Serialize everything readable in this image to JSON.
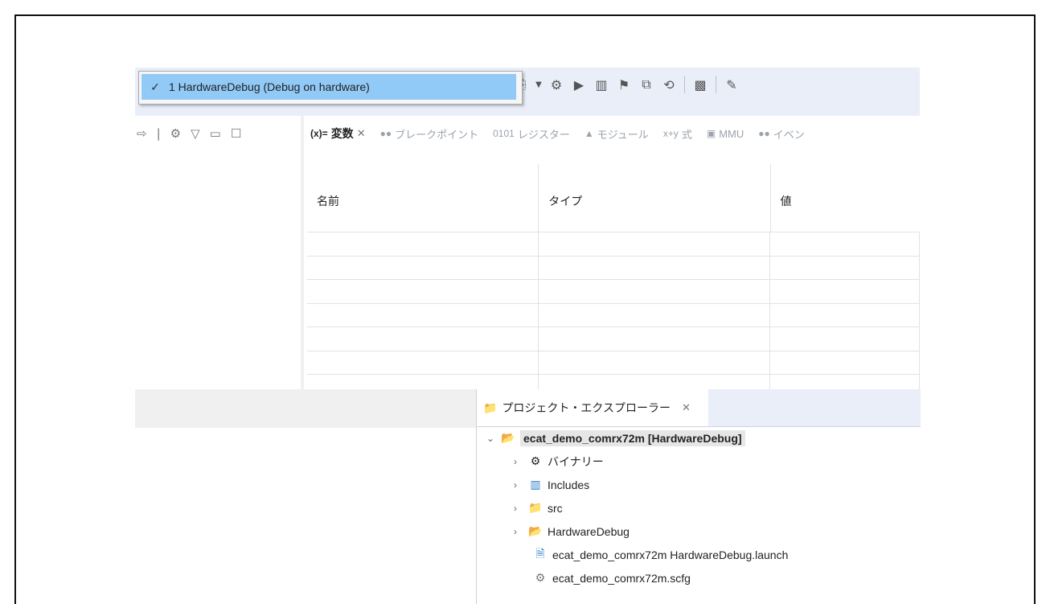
{
  "run_menu": {
    "items": [
      {
        "index_label": "1 HardwareDebug (Debug on hardware)",
        "checked": true
      }
    ]
  },
  "toolbar": {
    "icons": [
      "hammer-icon",
      "binary-icon",
      "debug-monitor-icon",
      "skip-breakpoints-icon",
      "resume-icon",
      "suspend-icon",
      "terminate-icon",
      "disconnect-icon",
      "step-into-icon",
      "step-over-icon",
      "step-return-icon",
      "instruction-step-icon",
      "use-step-filters-icon",
      "pin-icon",
      "resume-with-icon",
      "group-icon",
      "stack-icon",
      "restart-icon",
      "c-source-icon",
      "pencil-icon"
    ]
  },
  "variables_view": {
    "tabs": [
      {
        "label": "変数",
        "icon": "(x)=",
        "active": true
      },
      {
        "label": "ブレークポイント",
        "icon": "●●"
      },
      {
        "label": "レジスター",
        "icon": "0101"
      },
      {
        "label": "モジュール",
        "icon": "▲"
      },
      {
        "label": "式",
        "icon": "x+y"
      },
      {
        "label": "MMU",
        "icon": "▣"
      },
      {
        "label": "イベン",
        "icon": "●●"
      }
    ],
    "columns": [
      "名前",
      "タイプ",
      "値"
    ],
    "row_count": 7
  },
  "project_explorer": {
    "tab_label": "プロジェクト・エクスプローラー",
    "root": {
      "label": "ecat_demo_comrx72m [HardwareDebug]",
      "expanded": true
    },
    "children": [
      {
        "label": "バイナリー",
        "icon": "binaries-icon",
        "expandable": true
      },
      {
        "label": "Includes",
        "icon": "includes-icon",
        "expandable": true
      },
      {
        "label": "src",
        "icon": "source-folder-icon",
        "expandable": true
      },
      {
        "label": "HardwareDebug",
        "icon": "folder-icon",
        "expandable": true
      },
      {
        "label": "ecat_demo_comrx72m HardwareDebug.launch",
        "icon": "launch-file-icon",
        "expandable": false
      },
      {
        "label": "ecat_demo_comrx72m.scfg",
        "icon": "gear-file-icon",
        "expandable": false
      }
    ]
  },
  "colors": {
    "menu_highlight": "#91c9f7",
    "toolbar_bg": "#e9eef8"
  }
}
